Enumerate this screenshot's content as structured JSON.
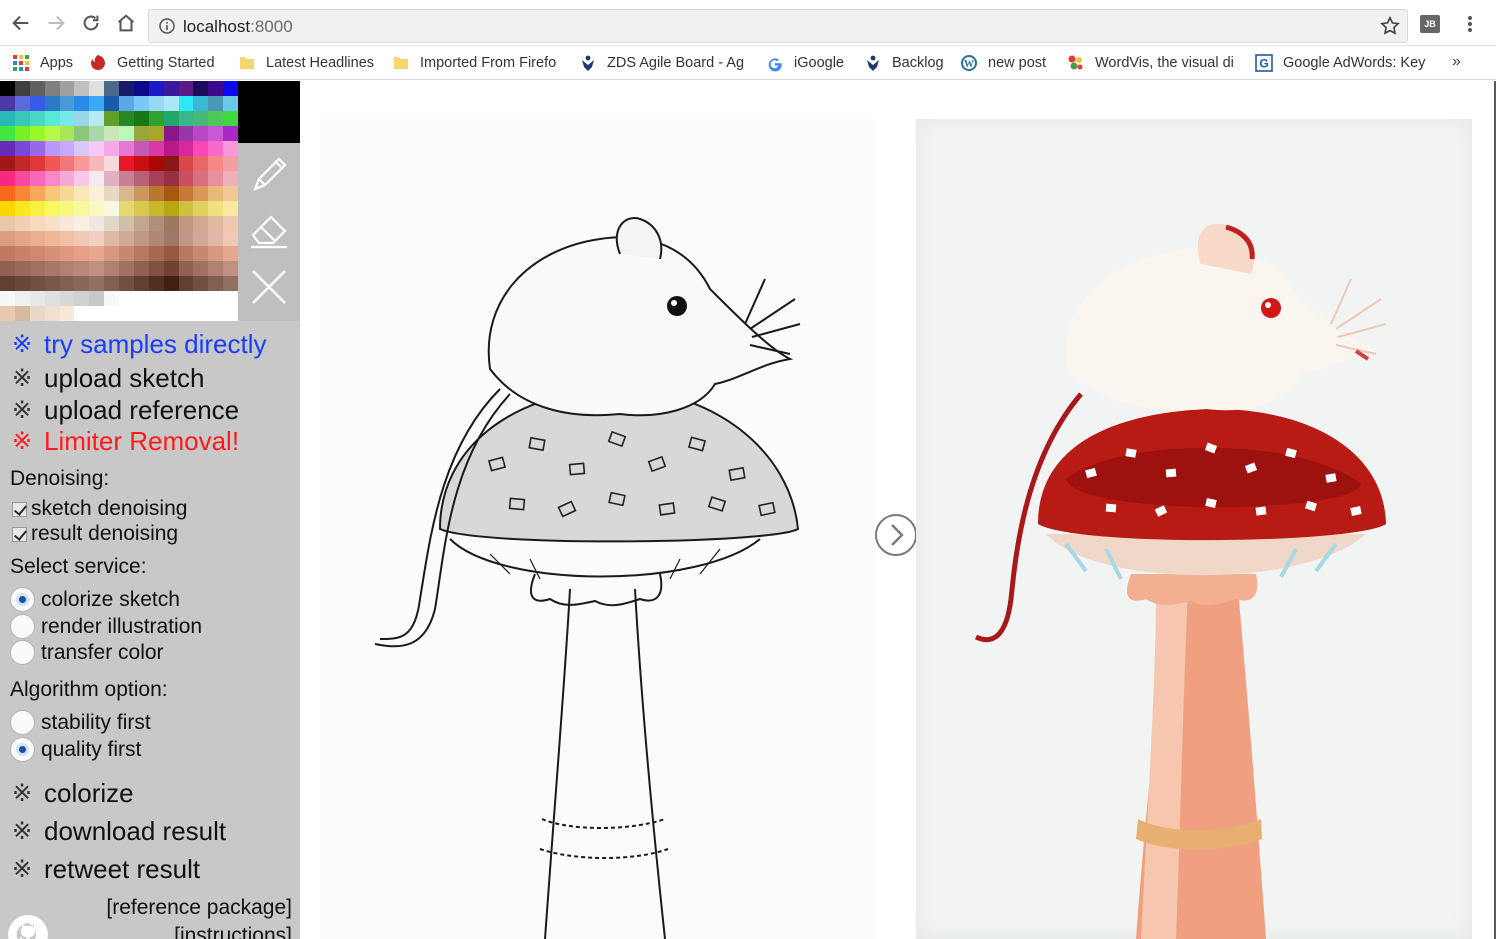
{
  "browser": {
    "url_host": "localhost",
    "url_port": ":8000",
    "bookmarks": [
      {
        "label": "Apps",
        "icon": "apps-grid-icon"
      },
      {
        "label": "Getting Started",
        "icon": "firefox-getting-started-icon"
      },
      {
        "label": "Latest Headlines",
        "icon": "folder-icon"
      },
      {
        "label": "Imported From Firefo",
        "icon": "folder-icon"
      },
      {
        "label": "ZDS Agile Board - Ag",
        "icon": "jira-icon"
      },
      {
        "label": "iGoogle",
        "icon": "google-icon"
      },
      {
        "label": "Backlog",
        "icon": "jira-icon"
      },
      {
        "label": "new post",
        "icon": "wordpress-icon"
      },
      {
        "label": "WordVis, the visual di",
        "icon": "wordvis-icon"
      },
      {
        "label": "Google AdWords: Key",
        "icon": "google-adwords-icon"
      }
    ],
    "more_bookmarks": "»",
    "extension_label": "JB"
  },
  "colors": {
    "accent_link": "#1a3cff",
    "danger_link": "#ff1a1a",
    "panel_bg": "#c8c8c8",
    "current_color": "#000000"
  },
  "palette": [
    "#000000",
    "#404040",
    "#606060",
    "#808080",
    "#a0a0a0",
    "#c0c0c0",
    "#e0e0e0",
    "#4a6a8a",
    "#1a1a6a",
    "#0a0a8a",
    "#1a1ac8",
    "#3a1a9a",
    "#5a1a8a",
    "#1a0a5a",
    "#3a0a8a",
    "#0a0af0",
    "#4a3aa8",
    "#5a6ad8",
    "#3a5ae8",
    "#2a7ac8",
    "#4a9ad8",
    "#2a8ae8",
    "#3aaaf8",
    "#1a5aa8",
    "#5aa8e8",
    "#7ac8f8",
    "#9ad8f8",
    "#aae8f8",
    "#2ae8f8",
    "#3ab8d8",
    "#4a98b8",
    "#6ac8e8",
    "#28b8b8",
    "#38c8b8",
    "#48d8c8",
    "#58e8d8",
    "#78e8e8",
    "#98d8e8",
    "#b8e8f0",
    "#60a028",
    "#288828",
    "#187818",
    "#30a030",
    "#20a868",
    "#38b888",
    "#48b878",
    "#50c858",
    "#40d840",
    "#40e840",
    "#78f028",
    "#98f828",
    "#b8f848",
    "#a8e858",
    "#88c878",
    "#a8d8a8",
    "#c8e8b8",
    "#b8f8b8",
    "#98a838",
    "#a8a828",
    "#881888",
    "#9838a8",
    "#b848c8",
    "#c858d8",
    "#a828c8",
    "#6828b8",
    "#7848d8",
    "#9868e8",
    "#b898f8",
    "#c8a8f8",
    "#d8c8f8",
    "#f8c8f8",
    "#f8a8e8",
    "#e878d8",
    "#c858b8",
    "#d838a8",
    "#b81888",
    "#d82898",
    "#f848b8",
    "#f868c8",
    "#f898d8",
    "#a01818",
    "#c02828",
    "#e03838",
    "#f05858",
    "#f07878",
    "#f89898",
    "#f8b8b8",
    "#f8d8d8",
    "#e81828",
    "#c81010",
    "#a80808",
    "#881818",
    "#d84848",
    "#e86868",
    "#f88888",
    "#f0a0a0",
    "#f82880",
    "#f848a0",
    "#f868b8",
    "#f888c8",
    "#f8a8d8",
    "#f8c8e8",
    "#f8e8f0",
    "#e0b0c0",
    "#c88098",
    "#b86078",
    "#a84058",
    "#983040",
    "#c85060",
    "#d87080",
    "#e890a0",
    "#f0b0b8",
    "#f86818",
    "#f88838",
    "#f8a858",
    "#f8c878",
    "#f8d898",
    "#f8e8b8",
    "#f8f0d8",
    "#e8d8c0",
    "#d8b890",
    "#c89860",
    "#b87830",
    "#a85810",
    "#c87838",
    "#d89858",
    "#e8b878",
    "#f0c898",
    "#f8d800",
    "#f8e820",
    "#f8f040",
    "#f8f860",
    "#f8f880",
    "#f8f8a0",
    "#f8f8c0",
    "#f8f8e0",
    "#e8d870",
    "#d8c850",
    "#c8b830",
    "#b8a810",
    "#d0c040",
    "#e0d060",
    "#f0e080",
    "#f8e8a0",
    "#e8c8a8",
    "#f0d0b0",
    "#f8d8c0",
    "#f8e0c8",
    "#f8e8d8",
    "#f8f0e0",
    "#f0e8e0",
    "#e0d8c8",
    "#d0c0a8",
    "#c0a890",
    "#b09078",
    "#a07860",
    "#c09880",
    "#d0a890",
    "#e0b8a0",
    "#f0c8b0",
    "#d8a080",
    "#e0a888",
    "#e8b090",
    "#f0b898",
    "#f0c0a8",
    "#f0c8b8",
    "#f0d0c0",
    "#e0b8a8",
    "#d0a898",
    "#c09888",
    "#b08878",
    "#a07868",
    "#c09888",
    "#d0a898",
    "#e0b8a8",
    "#f0c8b8",
    "#c07860",
    "#c88068",
    "#d08870",
    "#d89078",
    "#e09880",
    "#e8a088",
    "#e8a890",
    "#d89880",
    "#c88870",
    "#b87860",
    "#a86850",
    "#985840",
    "#b87860",
    "#c88870",
    "#d89880",
    "#e8a890",
    "#906050",
    "#986858",
    "#a07060",
    "#a87868",
    "#b08070",
    "#b88878",
    "#c09080",
    "#b08070",
    "#a07060",
    "#906050",
    "#805040",
    "#704030",
    "#906050",
    "#a07060",
    "#b08070",
    "#c09080",
    "#604030",
    "#684838",
    "#705040",
    "#785848",
    "#806050",
    "#886858",
    "#907060",
    "#806050",
    "#705040",
    "#604030",
    "#503020",
    "#402010",
    "#604030",
    "#705040",
    "#806050",
    "#907060",
    "#f8f8f8",
    "#f0f0f0",
    "#e8e8e8",
    "#e0e0e0",
    "#d8d8d8",
    "#d0d0d0",
    "#c8c8c8",
    "#f8f8f8",
    "#ffffff",
    "#ffffff",
    "#ffffff",
    "#ffffff",
    "#ffffff",
    "#ffffff",
    "#ffffff",
    "#ffffff",
    "#e8c8b0",
    "#d8b8a0",
    "#e8d8c8",
    "#f0e0d0",
    "#f8e8d8",
    "#ffffff",
    "#ffffff",
    "#ffffff",
    "#ffffff",
    "#ffffff",
    "#ffffff",
    "#ffffff",
    "#ffffff",
    "#ffffff",
    "#ffffff",
    "#ffffff"
  ],
  "menu": {
    "mark": "※",
    "try_samples": "try samples directly",
    "upload_sketch": "upload sketch",
    "upload_reference": "upload reference",
    "limiter_removal": "Limiter Removal!"
  },
  "denoising": {
    "label": "Denoising:",
    "sketch": "sketch denoising",
    "result": "result denoising"
  },
  "service": {
    "label": "Select service:",
    "options": [
      "colorize sketch",
      "render illustration",
      "transfer color"
    ],
    "selected": "colorize sketch"
  },
  "algorithm": {
    "label": "Algorithm option:",
    "options": [
      "stability first",
      "quality first"
    ],
    "selected": "quality first"
  },
  "actions": {
    "colorize": "colorize",
    "download": "download result",
    "retweet": "retweet result"
  },
  "links": {
    "reference_package": "[reference package]",
    "instructions": "[instructions]"
  }
}
